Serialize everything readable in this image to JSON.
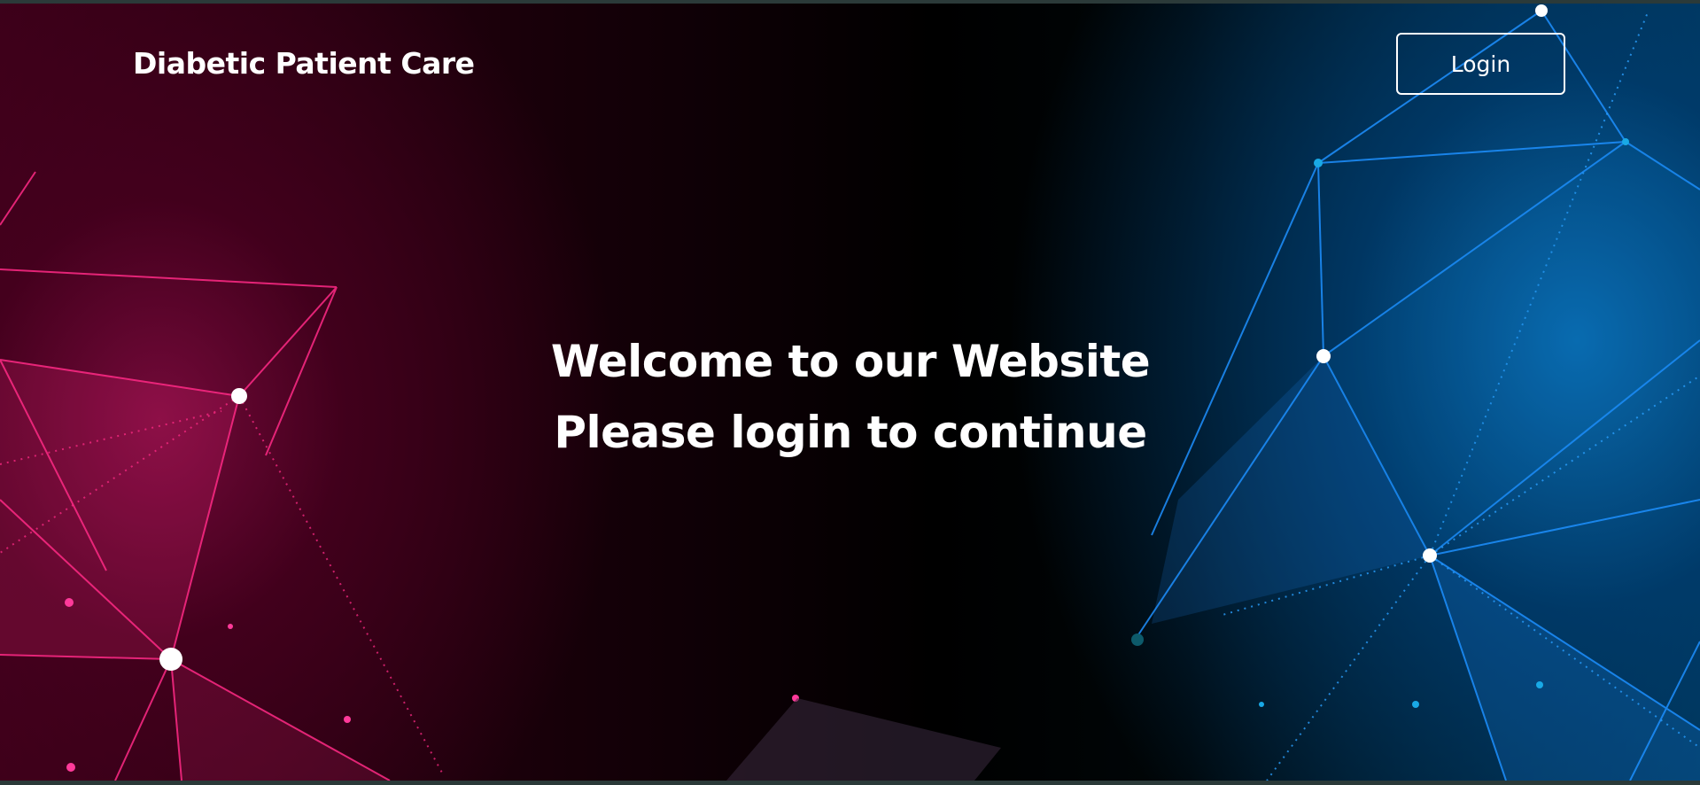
{
  "header": {
    "brand_title": "Diabetic Patient Care",
    "login_label": "Login"
  },
  "hero": {
    "line1": "Welcome to our Website",
    "line2": "Please login to continue"
  },
  "colors": {
    "text": "#ffffff",
    "left_glow": "#ff1a7a",
    "right_glow": "#1e90ff",
    "background": "#000000"
  }
}
